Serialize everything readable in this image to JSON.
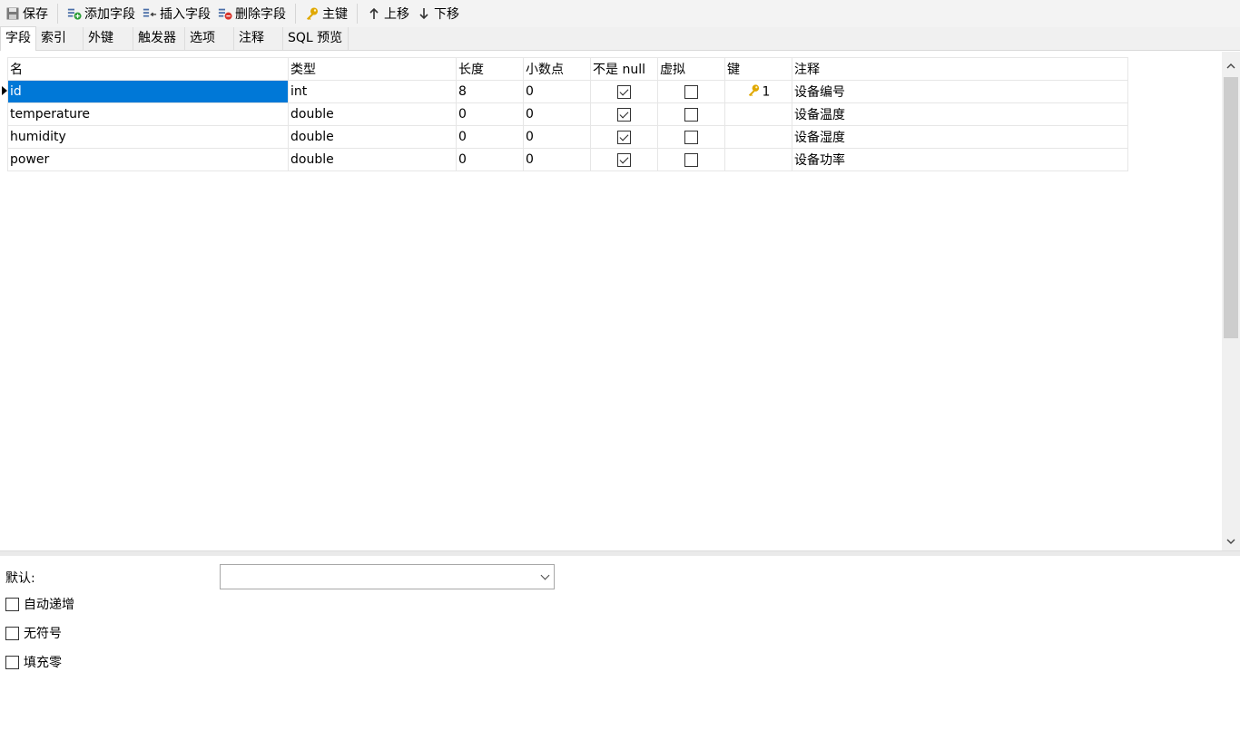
{
  "toolbar": {
    "save": "保存",
    "add_field": "添加字段",
    "insert_field": "插入字段",
    "delete_field": "删除字段",
    "primary_key": "主键",
    "move_up": "上移",
    "move_down": "下移"
  },
  "tabs": [
    "字段",
    "索引",
    "外键",
    "触发器",
    "选项",
    "注释",
    "SQL 预览"
  ],
  "active_tab": "字段",
  "grid": {
    "columns": [
      "名",
      "类型",
      "长度",
      "小数点",
      "不是 null",
      "虚拟",
      "键",
      "注释"
    ],
    "rows": [
      {
        "name": "id",
        "type": "int",
        "length": "8",
        "decimals": "0",
        "not_null": true,
        "virtual": false,
        "key": "1",
        "comment": "设备编号",
        "selected": true
      },
      {
        "name": "temperature",
        "type": "double",
        "length": "0",
        "decimals": "0",
        "not_null": true,
        "virtual": false,
        "key": "",
        "comment": "设备温度"
      },
      {
        "name": "humidity",
        "type": "double",
        "length": "0",
        "decimals": "0",
        "not_null": true,
        "virtual": false,
        "key": "",
        "comment": "设备湿度"
      },
      {
        "name": "power",
        "type": "double",
        "length": "0",
        "decimals": "0",
        "not_null": true,
        "virtual": false,
        "key": "",
        "comment": "设备功率"
      }
    ]
  },
  "props": {
    "default_label": "默认:",
    "default_value": "",
    "auto_increment": "自动递增",
    "unsigned": "无符号",
    "zerofill": "填充零"
  },
  "colors": {
    "selection": "#0078d7",
    "key_icon": "#e0a800",
    "add_icon": "#2e9e3a",
    "delete_icon": "#d9342b"
  }
}
